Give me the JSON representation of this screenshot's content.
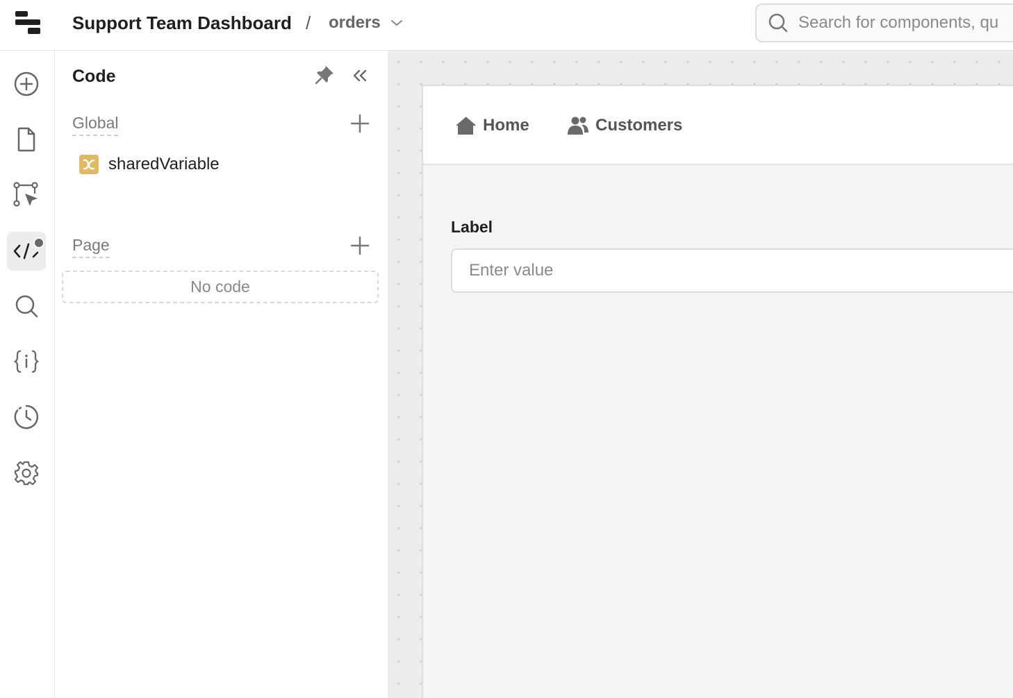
{
  "header": {
    "app_title": "Support Team Dashboard",
    "separator": "/",
    "page_name": "orders",
    "search_placeholder": "Search for components, qu"
  },
  "rail": {
    "items": [
      {
        "icon": "add-circle-icon"
      },
      {
        "icon": "page-icon"
      },
      {
        "icon": "workflow-icon"
      },
      {
        "icon": "code-icon",
        "active": true
      },
      {
        "icon": "search-icon"
      },
      {
        "icon": "state-icon"
      },
      {
        "icon": "history-icon"
      },
      {
        "icon": "settings-icon"
      }
    ]
  },
  "code_panel": {
    "title": "Code",
    "global_label": "Global",
    "global_items": [
      {
        "name": "sharedVariable",
        "icon": "variable-icon",
        "color": "#e3b862"
      }
    ],
    "page_label": "Page",
    "page_empty": "No code"
  },
  "canvas": {
    "nav": [
      {
        "label": "Home",
        "icon": "home-icon"
      },
      {
        "label": "Customers",
        "icon": "users-icon"
      }
    ],
    "field_label": "Label",
    "field_placeholder": "Enter value"
  }
}
